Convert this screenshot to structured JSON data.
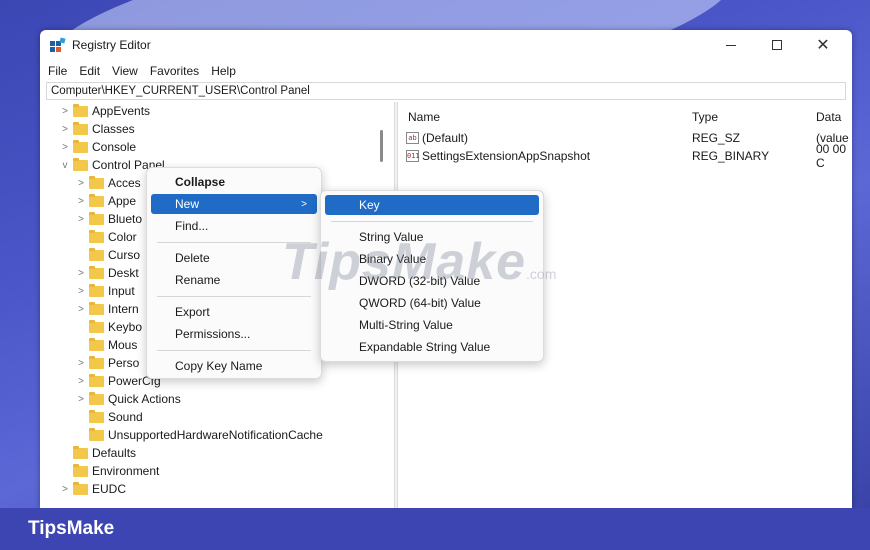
{
  "window": {
    "title": "Registry Editor",
    "controls": {
      "minimize": "—",
      "maximize": "☐",
      "close": "✕"
    }
  },
  "menu": [
    "File",
    "Edit",
    "View",
    "Favorites",
    "Help"
  ],
  "address": "Computer\\HKEY_CURRENT_USER\\Control Panel",
  "tree": [
    {
      "label": "AppEvents",
      "chevron": ">"
    },
    {
      "label": "Classes",
      "chevron": ">"
    },
    {
      "label": "Console",
      "chevron": ">"
    },
    {
      "label": "Control Panel",
      "chevron": "v"
    },
    {
      "label": "Acces",
      "chevron": ">"
    },
    {
      "label": "Appe",
      "chevron": ">"
    },
    {
      "label": "Blueto",
      "chevron": ">"
    },
    {
      "label": "Color",
      "chevron": ""
    },
    {
      "label": "Curso",
      "chevron": ""
    },
    {
      "label": "Deskt",
      "chevron": ">"
    },
    {
      "label": "Input",
      "chevron": ">"
    },
    {
      "label": "Intern",
      "chevron": ">"
    },
    {
      "label": "Keybo",
      "chevron": ""
    },
    {
      "label": "Mous",
      "chevron": ""
    },
    {
      "label": "Perso",
      "chevron": ">"
    },
    {
      "label": "PowerCfg",
      "chevron": ">"
    },
    {
      "label": "Quick Actions",
      "chevron": ">"
    },
    {
      "label": "Sound",
      "chevron": ""
    },
    {
      "label": "UnsupportedHardwareNotificationCache",
      "chevron": ""
    },
    {
      "label": "Defaults",
      "chevron": ""
    },
    {
      "label": "Environment",
      "chevron": ""
    },
    {
      "label": "EUDC",
      "chevron": ">"
    }
  ],
  "list": {
    "columns": {
      "name": "Name",
      "type": "Type",
      "data": "Data"
    },
    "rows": [
      {
        "icon": "ab",
        "name": "(Default)",
        "type": "REG_SZ",
        "data": "(value"
      },
      {
        "icon": "011",
        "name": "SettingsExtensionAppSnapshot",
        "type": "REG_BINARY",
        "data": "00 00 C"
      }
    ]
  },
  "context_menu": {
    "collapse": "Collapse",
    "new": "New",
    "new_arrow": ">",
    "find": "Find...",
    "delete": "Delete",
    "rename": "Rename",
    "export": "Export",
    "permissions": "Permissions...",
    "copy_key_name": "Copy Key Name"
  },
  "submenu": {
    "key": "Key",
    "string_value": "String Value",
    "binary_value": "Binary Value",
    "dword_value": "DWORD (32-bit) Value",
    "qword_value": "QWORD (64-bit) Value",
    "multi_string_value": "Multi-String Value",
    "expandable_string_value": "Expandable String Value"
  },
  "watermark": {
    "brand": "TipsMake",
    "domain": ".com"
  },
  "footer": {
    "brand": "TipsMake"
  },
  "colors": {
    "highlight": "#1f6bc5",
    "footer": "#3d45b2",
    "folder": "#f2c84b"
  }
}
